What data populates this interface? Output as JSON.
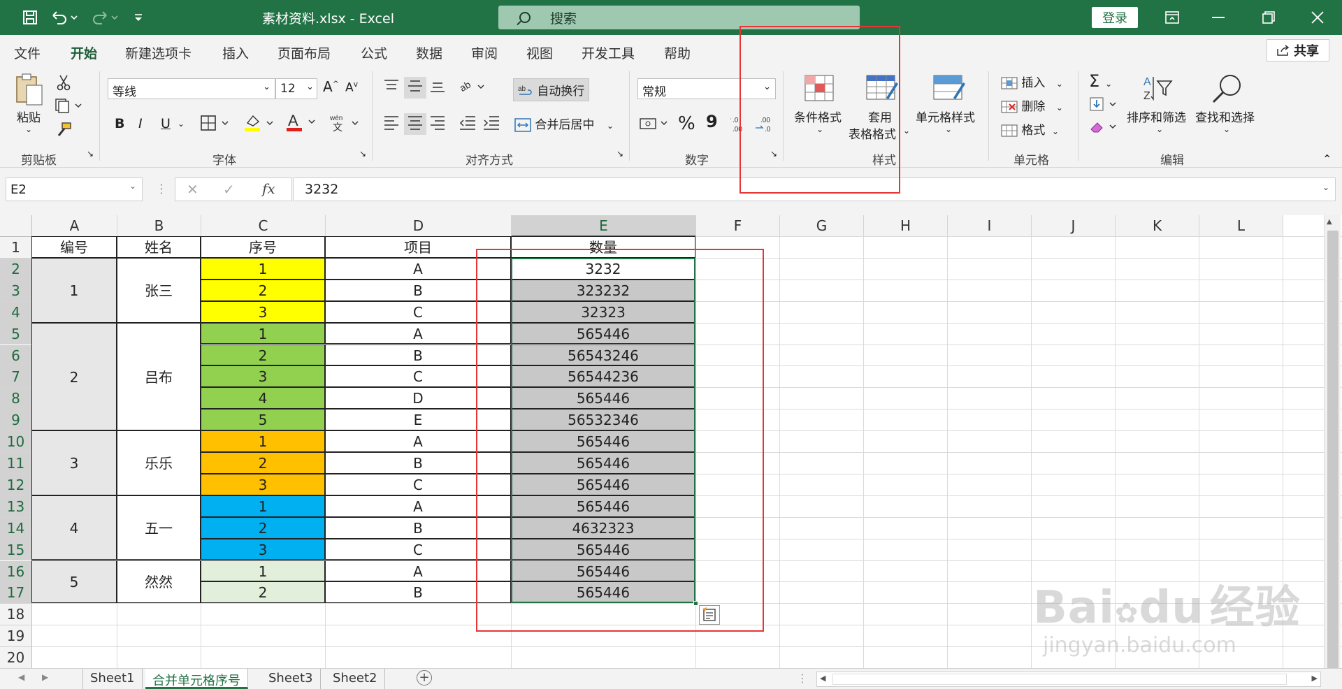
{
  "window": {
    "file_title": "素材资料.xlsx  -  Excel",
    "search_placeholder": "搜索",
    "login_label": "登录"
  },
  "menu": {
    "items": [
      "文件",
      "开始",
      "新建选项卡",
      "插入",
      "页面布局",
      "公式",
      "数据",
      "审阅",
      "视图",
      "开发工具",
      "帮助"
    ],
    "active": "开始",
    "share_label": "共享"
  },
  "ribbon": {
    "clipboard": {
      "paste": "粘贴",
      "group": "剪贴板"
    },
    "font": {
      "name": "等线",
      "size": "12",
      "bold": "B",
      "italic": "I",
      "underline": "U",
      "group": "字体"
    },
    "alignment": {
      "wrap": "自动换行",
      "merge": "合并后居中",
      "group": "对齐方式"
    },
    "number": {
      "format": "常规",
      "percent": "%",
      "comma": "9",
      "group": "数字"
    },
    "styles": {
      "conditional": "条件格式",
      "table_line1": "套用",
      "table_line2": "表格格式",
      "cell_styles": "单元格样式",
      "group": "样式"
    },
    "cells": {
      "insert": "插入",
      "delete": "删除",
      "format": "格式",
      "group": "单元格"
    },
    "editing": {
      "sort": "排序和筛选",
      "find": "查找和选择",
      "group": "编辑"
    }
  },
  "formula_bar": {
    "name_box": "E2",
    "formula": "3232",
    "fx": "fx"
  },
  "sheet": {
    "columns": [
      "A",
      "B",
      "C",
      "D",
      "E",
      "F",
      "G",
      "H",
      "I",
      "J",
      "K",
      "L"
    ],
    "selected_column": "E",
    "row_numbers": [
      "1",
      "2",
      "3",
      "4",
      "5",
      "6",
      "7",
      "8",
      "9",
      "10",
      "11",
      "12",
      "13",
      "14",
      "15",
      "16",
      "17",
      "18",
      "19",
      "20"
    ],
    "headers": [
      "编号",
      "姓名",
      "序号",
      "项目",
      "数量"
    ],
    "groups": [
      {
        "id": "1",
        "name": "张三"
      },
      {
        "id": "2",
        "name": "吕布"
      },
      {
        "id": "3",
        "name": "乐乐"
      },
      {
        "id": "4",
        "name": "五一"
      },
      {
        "id": "5",
        "name": "然然"
      }
    ],
    "rows": [
      {
        "seq": "1",
        "item": "A",
        "qty": "3232"
      },
      {
        "seq": "2",
        "item": "B",
        "qty": "323232"
      },
      {
        "seq": "3",
        "item": "C",
        "qty": "32323"
      },
      {
        "seq": "1",
        "item": "A",
        "qty": "565446"
      },
      {
        "seq": "2",
        "item": "B",
        "qty": "56543246"
      },
      {
        "seq": "3",
        "item": "C",
        "qty": "56544236"
      },
      {
        "seq": "4",
        "item": "D",
        "qty": "565446"
      },
      {
        "seq": "5",
        "item": "E",
        "qty": "56532346"
      },
      {
        "seq": "1",
        "item": "A",
        "qty": "565446"
      },
      {
        "seq": "2",
        "item": "B",
        "qty": "565446"
      },
      {
        "seq": "3",
        "item": "C",
        "qty": "565446"
      },
      {
        "seq": "1",
        "item": "A",
        "qty": "565446"
      },
      {
        "seq": "2",
        "item": "B",
        "qty": "4632323"
      },
      {
        "seq": "3",
        "item": "C",
        "qty": "565446"
      },
      {
        "seq": "1",
        "item": "A",
        "qty": "565446"
      },
      {
        "seq": "2",
        "item": "B",
        "qty": "565446"
      }
    ],
    "colors": {
      "yellow": "#ffff00",
      "green": "#92d050",
      "orange": "#ffc000",
      "blue": "#00b0f0",
      "pale": "#e2efda",
      "gray_fill": "#c8c8c8",
      "merged_gray": "#e7e7e7"
    }
  },
  "tabs": {
    "items": [
      "Sheet1",
      "合并单元格序号",
      "Sheet3",
      "Sheet2"
    ],
    "active": "合并单元格序号"
  },
  "watermark": {
    "brand": "Bai",
    "brand2": "du",
    "site": "经验",
    "url": "jingyan.baidu.com"
  }
}
